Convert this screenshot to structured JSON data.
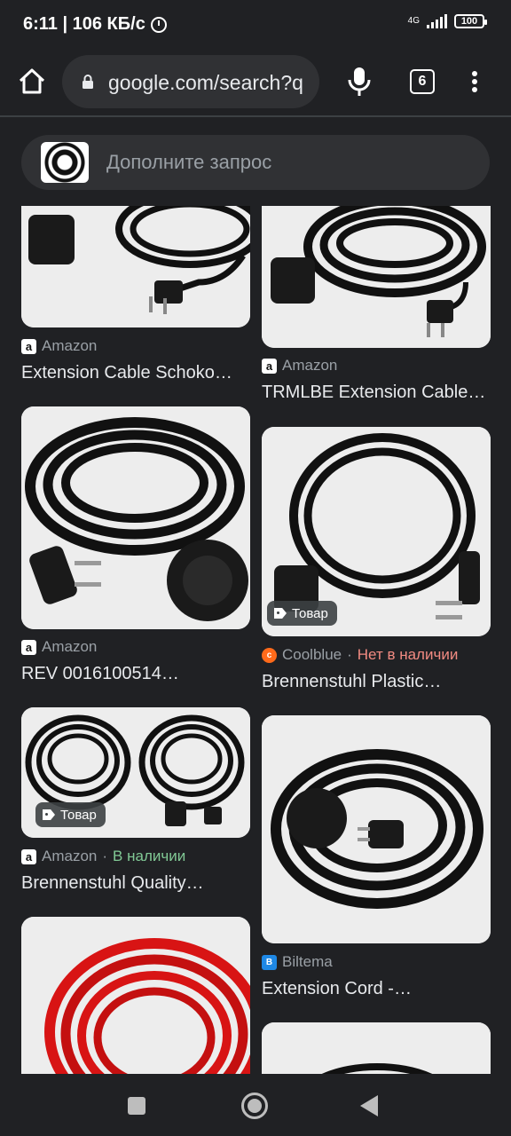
{
  "status_bar": {
    "time_speed": "6:11 | 106 КБ/с",
    "network": "4G",
    "battery": "100"
  },
  "browser": {
    "url": "google.com/search?q",
    "tab_count": "6"
  },
  "search": {
    "placeholder": "Дополните запрос"
  },
  "results": [
    {
      "source": "Amazon",
      "favicon": "amazon-favicon",
      "availability": "",
      "title": "Extension Cable Schoko…",
      "badge": ""
    },
    {
      "source": "Amazon",
      "favicon": "amazon-favicon",
      "availability": "",
      "title": "TRMLBE Extension Cable…",
      "badge": ""
    },
    {
      "source": "Amazon",
      "favicon": "amazon-favicon",
      "availability": "",
      "title": "REV 0016100514…",
      "badge": ""
    },
    {
      "source": "Coolblue",
      "favicon": "coolblue-favicon",
      "availability": "Нет в наличии",
      "title": "Brennenstuhl Plastic…",
      "badge": "Товар"
    },
    {
      "source": "Amazon",
      "favicon": "amazon-favicon",
      "availability": "В наличии",
      "title": "Brennenstuhl Quality…",
      "badge": "Товар"
    },
    {
      "source": "Biltema",
      "favicon": "biltema-favicon",
      "availability": "",
      "title": "Extension Cord -…",
      "badge": ""
    }
  ],
  "separator": "·",
  "colors": {
    "background": "#202124",
    "surface": "#303134",
    "text": "#e8eaed",
    "muted": "#9aa0a6",
    "in_stock": "#81c995",
    "out_of_stock": "#f28b82"
  }
}
